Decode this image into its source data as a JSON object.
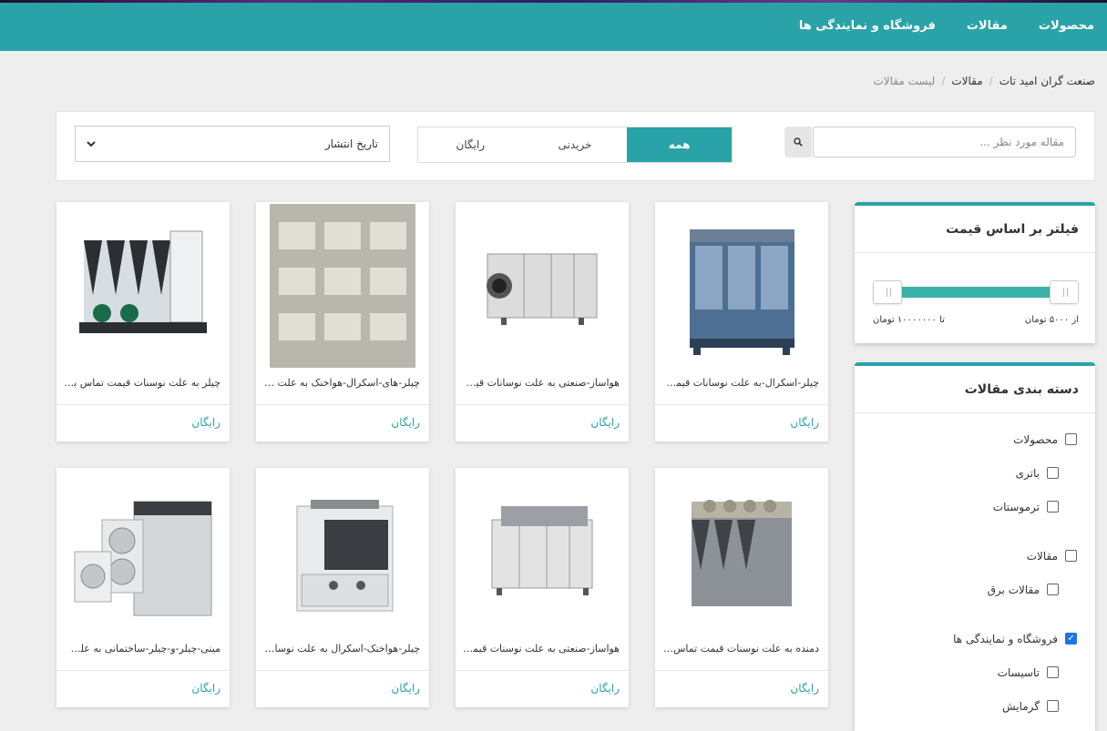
{
  "nav": [
    {
      "label": "محصولات"
    },
    {
      "label": "مقالات"
    },
    {
      "label": "فروشگاه و نمایندگی ها"
    }
  ],
  "breadcrumb": {
    "home": "صنعت گران امید تات",
    "section": "مقالات",
    "current": "لیست مقالات",
    "separator": "/"
  },
  "search": {
    "placeholder": "مقاله مورد نظر ...",
    "icon": "search-icon"
  },
  "tabs": [
    {
      "label": "همه",
      "active": true
    },
    {
      "label": "خریدنی",
      "active": false
    },
    {
      "label": "رایگان",
      "active": false
    }
  ],
  "sort": {
    "selected": "تاریخ انتشار",
    "icon": "chevron-down-icon"
  },
  "price_filter": {
    "title": "فیلتر بر اساس قیمت",
    "min_label": "از ۵۰۰۰ تومان",
    "max_label": "تا ۱۰۰۰۰۰۰۰ تومان"
  },
  "categories": {
    "title": "دسته بندی مقالات",
    "items": [
      {
        "label": "محصولات",
        "level": "parent",
        "checked": false
      },
      {
        "label": "باتری",
        "level": "child",
        "checked": false
      },
      {
        "label": "ترموستات",
        "level": "child",
        "checked": false
      },
      {
        "label": "مقالات",
        "level": "parent",
        "checked": false
      },
      {
        "label": "مقالات برق",
        "level": "child",
        "checked": false
      },
      {
        "label": "فروشگاه و نمایندگی ها",
        "level": "parent",
        "checked": true
      },
      {
        "label": "تاسیسات",
        "level": "child",
        "checked": false
      },
      {
        "label": "گرمایش",
        "level": "child",
        "checked": false
      }
    ]
  },
  "cards": [
    {
      "title": "چیلر-اسکرال-به علت نوسانات قیمت تماس بگیرید",
      "price": "رایگان"
    },
    {
      "title": "هواساز-صنعتی به علت نوسانات قیمت تماس بگیرید",
      "price": "رایگان"
    },
    {
      "title": "چیلر-های-اسکرال-هواخنک به علت نوسانات قیمت",
      "price": "رایگان"
    },
    {
      "title": "چیلر به علت نوسنات قیمت تماس بگیرید",
      "price": "رایگان"
    },
    {
      "title": "دمنده به علت نوسنات قیمت تماس بگیرید",
      "price": "رایگان"
    },
    {
      "title": "هواساز-صنعتی به علت نوسنات قیمت تماس بگیرید",
      "price": "رایگان"
    },
    {
      "title": "چیلر-هواخنک-اسکرال به علت نوسانات قیمت",
      "price": "رایگان"
    },
    {
      "title": "مینی-چیلر-و-چیلر-ساختمانی به علت نوسانات",
      "price": "رایگان"
    }
  ],
  "colors": {
    "accent": "#2aa3a8",
    "checkbox": "#1e73e8"
  }
}
